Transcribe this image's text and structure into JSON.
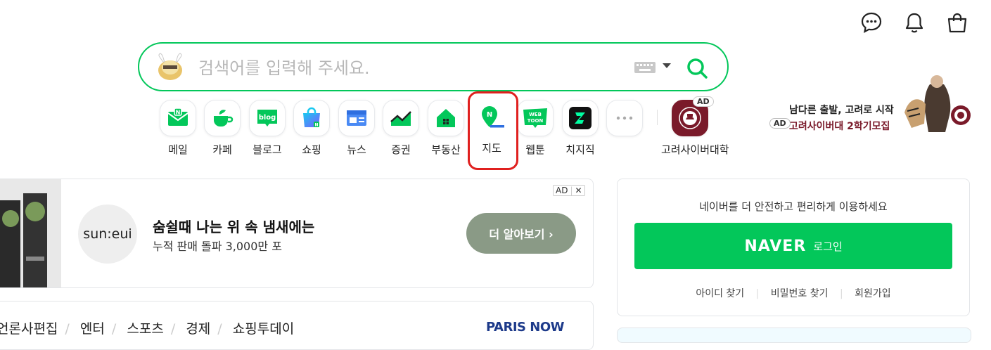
{
  "header": {
    "icons": [
      "talk-icon",
      "bell-icon",
      "shopping-bag-icon"
    ]
  },
  "search": {
    "placeholder": "검색어를 입력해 주세요."
  },
  "services": [
    {
      "label": "메일",
      "icon": "mail-icon"
    },
    {
      "label": "카페",
      "icon": "cafe-icon"
    },
    {
      "label": "블로그",
      "icon": "blog-icon",
      "icon_text": "blog"
    },
    {
      "label": "쇼핑",
      "icon": "shopping-icon"
    },
    {
      "label": "뉴스",
      "icon": "news-icon"
    },
    {
      "label": "증권",
      "icon": "stock-icon"
    },
    {
      "label": "부동산",
      "icon": "real-estate-icon"
    },
    {
      "label": "지도",
      "icon": "map-icon"
    },
    {
      "label": "웹툰",
      "icon": "webtoon-icon",
      "icon_text": "WEB TOON"
    },
    {
      "label": "치지직",
      "icon": "chzzk-icon"
    },
    {
      "label": "",
      "icon": "more-icon"
    },
    {
      "label": "고려사이버대학",
      "icon": "korea-cyber-univ-icon",
      "badge": "AD"
    }
  ],
  "side_ad": {
    "headline": "남다른 출발, 고려로 시작",
    "badge": "AD",
    "subline": "고려사이버대 2학기모집"
  },
  "banner_ad": {
    "badge": "AD",
    "close": "✕",
    "brand": "sun:eui",
    "title": "숨쉴때 나는 위 속 냄새에는",
    "subtitle": "누적 판매 돌파 3,000만 포",
    "cta": "더 알아보기 ›"
  },
  "login": {
    "message": "네이버를 더 안전하고 편리하게 이용하세요",
    "brand": "NAVER",
    "button_label": "로그인",
    "links": [
      "아이디 찾기",
      "비밀번호 찾기",
      "회원가입"
    ]
  },
  "news_tabs": {
    "items": [
      "언론사편집",
      "엔터",
      "스포츠",
      "경제",
      "쇼핑투데이"
    ],
    "logo": "PARIS NOW"
  },
  "colors": {
    "naver_green": "#03c75a",
    "highlight_red": "#e0201f",
    "cta_gray": "#8a9a86"
  }
}
